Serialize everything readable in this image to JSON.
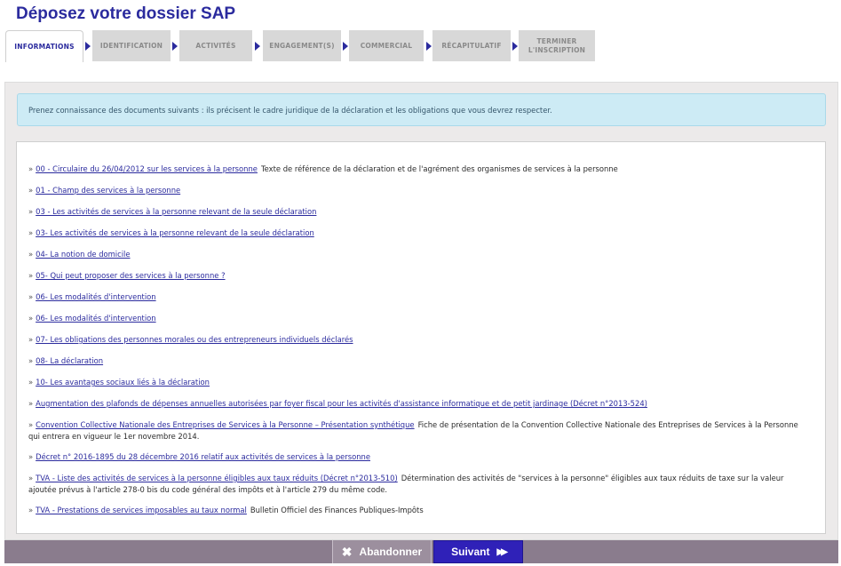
{
  "page": {
    "title": "Déposez votre dossier SAP"
  },
  "tabs": [
    {
      "label": "INFORMATIONS",
      "state": "active"
    },
    {
      "label": "IDENTIFICATION",
      "state": "inactive"
    },
    {
      "label": "ACTIVITÉS",
      "state": "inactive"
    },
    {
      "label": "ENGAGEMENT(S)",
      "state": "inactive"
    },
    {
      "label": "COMMERCIAL",
      "state": "inactive"
    },
    {
      "label": "RÉCAPITULATIF",
      "state": "inactive"
    },
    {
      "label": "TERMINER L'INSCRIPTION",
      "state": "inactive"
    }
  ],
  "info": {
    "text": "Prenez connaissance des documents suivants : ils précisent le cadre juridique de la déclaration et les obligations que vous devrez respecter."
  },
  "documents": [
    {
      "bullet": "»",
      "link": "00 - Circulaire du 26/04/2012 sur les services à la personne",
      "desc": "Texte de référence de la déclaration et de l'agrément des organismes de services à la personne"
    },
    {
      "bullet": "»",
      "link": "01 - Champ des services à la personne",
      "desc": ""
    },
    {
      "bullet": "»",
      "link": "03 - Les activités de services à la personne relevant de la seule déclaration",
      "desc": ""
    },
    {
      "bullet": "»",
      "link": "03- Les activités de services à la personne relevant de la seule déclaration",
      "desc": ""
    },
    {
      "bullet": "»",
      "link": "04- La notion de domicile",
      "desc": ""
    },
    {
      "bullet": "»",
      "link": "05- Qui peut proposer des services à la personne ?",
      "desc": ""
    },
    {
      "bullet": "»",
      "link": "06- Les modalités d'intervention",
      "desc": ""
    },
    {
      "bullet": "»",
      "link": "06- Les modalités d'intervention",
      "desc": ""
    },
    {
      "bullet": "»",
      "link": "07- Les obligations des personnes morales ou des entrepreneurs individuels déclarés",
      "desc": ""
    },
    {
      "bullet": "»",
      "link": "08- La déclaration",
      "desc": ""
    },
    {
      "bullet": "»",
      "link": "10- Les avantages sociaux liés à la déclaration",
      "desc": ""
    },
    {
      "bullet": "»",
      "link": "Augmentation des plafonds de dépenses annuelles autorisées par foyer fiscal pour les activités d'assistance informatique et de petit jardinage (Décret n°2013-524)",
      "desc": ""
    },
    {
      "bullet": "»",
      "link": "Convention Collective Nationale des Entreprises de Services à la Personne – Présentation synthétique",
      "desc": "Fiche de présentation de la Convention Collective Nationale des Entreprises de Services à la Personne qui entrera en vigueur le 1er novembre 2014."
    },
    {
      "bullet": "»",
      "link": "Décret n° 2016-1895 du 28 décembre 2016 relatif aux activités de services à la personne",
      "desc": ""
    },
    {
      "bullet": "»",
      "link": "TVA - Liste des activités de services à la personne éligibles aux taux réduits (Décret n°2013-510)",
      "desc": "Détermination des activités de \"services à la personne\" éligibles aux taux réduits de taxe sur la valeur ajoutée prévus à l'article 278-0 bis du code général des impôts et à l'article 279 du même code."
    },
    {
      "bullet": "»",
      "link": "TVA - Prestations de services imposables au taux normal",
      "desc": "Bulletin Officiel des Finances Publiques-Impôts"
    }
  ],
  "footer": {
    "cancel_label": "Abandonner",
    "cancel_icon": "close-icon",
    "next_label": "Suivant",
    "next_icon": "fast-forward-icon"
  },
  "colors": {
    "brand": "#2b2b9e",
    "next_button": "#2f21b8",
    "footer_bar": "#8a7c8d",
    "info_bg": "#cdebf5"
  }
}
